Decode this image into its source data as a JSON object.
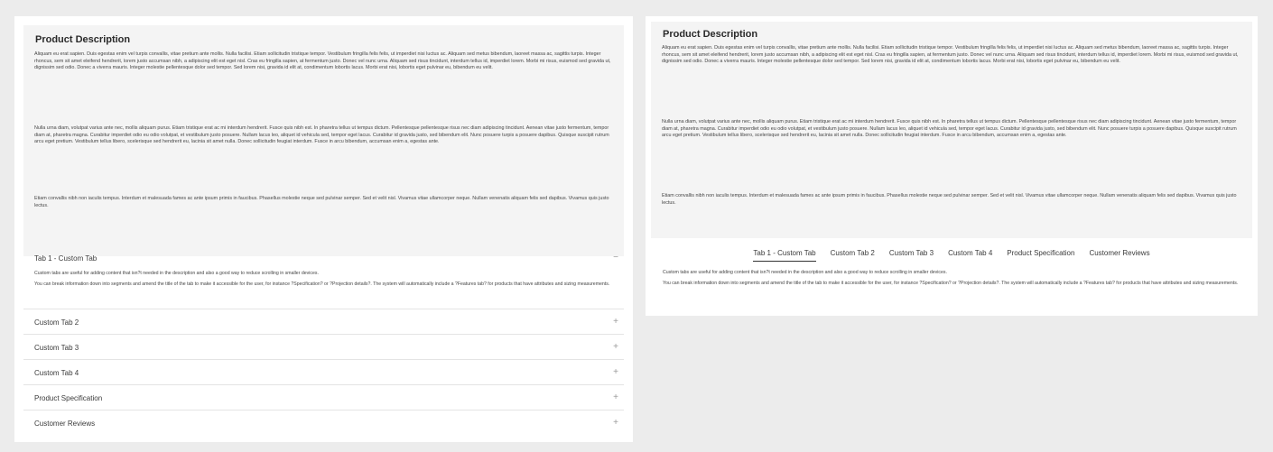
{
  "description": {
    "title": "Product Description",
    "p1": "Aliquam eu erat sapien. Duis egestas enim vel turpis convallis, vitae pretium ante mollis. Nulla facilisi. Etiam sollicitudin tristique tempor. Vestibulum fringilla felis felis, ut imperdiet nisi luctus ac. Aliquam sed metus bibendum, laoreet massa ac, sagittis turpis. Integer rhoncus, sem sit amet eleifend hendrerit, lorem justo accumsan nibh, a adipiscing elit est eget nisl. Cras eu fringilla sapien, at fermentum justo. Donec vel nunc urna. Aliquam sed risus tincidunt, interdum tellus id, imperdiet lorem. Morbi mi risus, euismod sed gravida ut, dignissim sed odio. Donec a viverra mauris. Integer molestie pellentesque dolor sed tempor. Sed lorem nisi, gravida id elit at, condimentum lobortis lacus. Morbi erat nisi, lobortis eget pulvinar eu, bibendum eu velit.",
    "p2": "Nulla urna diam, volutpat varius ante nec, mollis aliquam purus. Etiam tristique erat ac mi interdum hendrerit. Fusce quis nibh est. In pharetra tellus ut tempus dictum. Pellentesque pellentesque risus nec diam adipiscing tincidunt. Aenean vitae justo fermentum, tempor diam at, pharetra magna. Curabitur imperdiet odio eu odio volutpat, et vestibulum justo posuere. Nullam lacus leo, aliquet id vehicula sed, tempor eget lacus. Curabitur id gravida justo, sed bibendum elit. Nunc posuere turpis a posuere dapibus. Quisque suscipit rutrum arcu eget pretium. Vestibulum tellus libero, scelerisque sed hendrerit eu, lacinia sit amet nulla. Donec sollicitudin feugiat interdum. Fusce in arcu bibendum, accumsan enim a, egestas ante.",
    "p3": "Etiam convallis nibh non iaculis tempus. Interdum et malesuada fames ac ante ipsum primis in faucibus. Phasellus molestie neque sed pulvinar semper. Sed et velit nisl. Vivamus vitae ullamcorper neque. Nullam venenatis aliquam felis sed dapibus. Vivamus quis justo lectus."
  },
  "tabs": [
    {
      "label": "Tab 1 - Custom Tab"
    },
    {
      "label": "Custom Tab 2"
    },
    {
      "label": "Custom Tab 3"
    },
    {
      "label": "Custom Tab 4"
    },
    {
      "label": "Product Specification"
    },
    {
      "label": "Customer Reviews"
    }
  ],
  "tab_content": {
    "p1": "Custom tabs are useful for adding content that isn?t needed in the description and also a good way to reduce scrolling in smaller devices.",
    "p2": "You can break information down into segments and amend the title of the tab to make it accessible for the user, for instance ?Specification? or ?Projection details?. The system will automatically include a ?Features tab? for products that have attributes and sizing measurements."
  },
  "icons": {
    "collapse": "minus-icon",
    "expand": "plus-icon",
    "collapse_glyph": "−",
    "expand_glyph": "+"
  }
}
